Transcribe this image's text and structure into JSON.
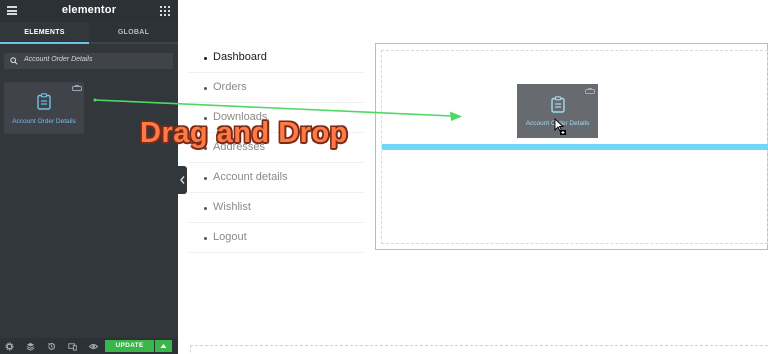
{
  "panel": {
    "brand": "elementor",
    "tabs": [
      "ELEMENTS",
      "GLOBAL"
    ],
    "search_value": "Account Order Details",
    "widget": {
      "label": "Account Order Details",
      "icon": "clipboard-icon"
    },
    "footer": {
      "update_label": "UPDATE"
    }
  },
  "account_nav": {
    "items": [
      "Dashboard",
      "Orders",
      "Downloads",
      "Addresses",
      "Account details",
      "Wishlist",
      "Logout"
    ]
  },
  "drag_ghost": {
    "label": "Account Order Details"
  },
  "annotation": {
    "text": "Drag and Drop"
  },
  "colors": {
    "accent": "#6ec1e4",
    "update": "#39b54a",
    "arrow": "#4cd964",
    "annotation": "#ff7a45"
  }
}
